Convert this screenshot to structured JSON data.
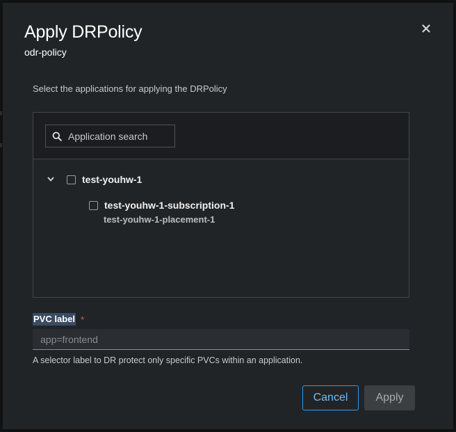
{
  "modal": {
    "title": "Apply DRPolicy",
    "subtitle": "odr-policy",
    "description": "Select the applications for applying the DRPolicy"
  },
  "icons": {
    "close": "close-icon",
    "search": "search-icon",
    "toggle": "chevron-down-icon"
  },
  "search": {
    "placeholder": "Application search",
    "value": ""
  },
  "tree": {
    "parent": {
      "label": "test-youhw-1",
      "checked": false,
      "expanded": true
    },
    "children": [
      {
        "label": "test-youhw-1-subscription-1",
        "sublabel": "test-youhw-1-placement-1",
        "checked": false
      }
    ]
  },
  "pvc": {
    "label": "PVC label",
    "required_marker": "*",
    "placeholder": "app=frontend",
    "value": "",
    "helper": "A selector label to DR protect only specific PVCs within an application."
  },
  "footer": {
    "cancel_label": "Cancel",
    "apply_label": "Apply"
  },
  "colors": {
    "accent": "#2b9af3",
    "required": "#e45a50",
    "modal_bg": "#212427"
  }
}
